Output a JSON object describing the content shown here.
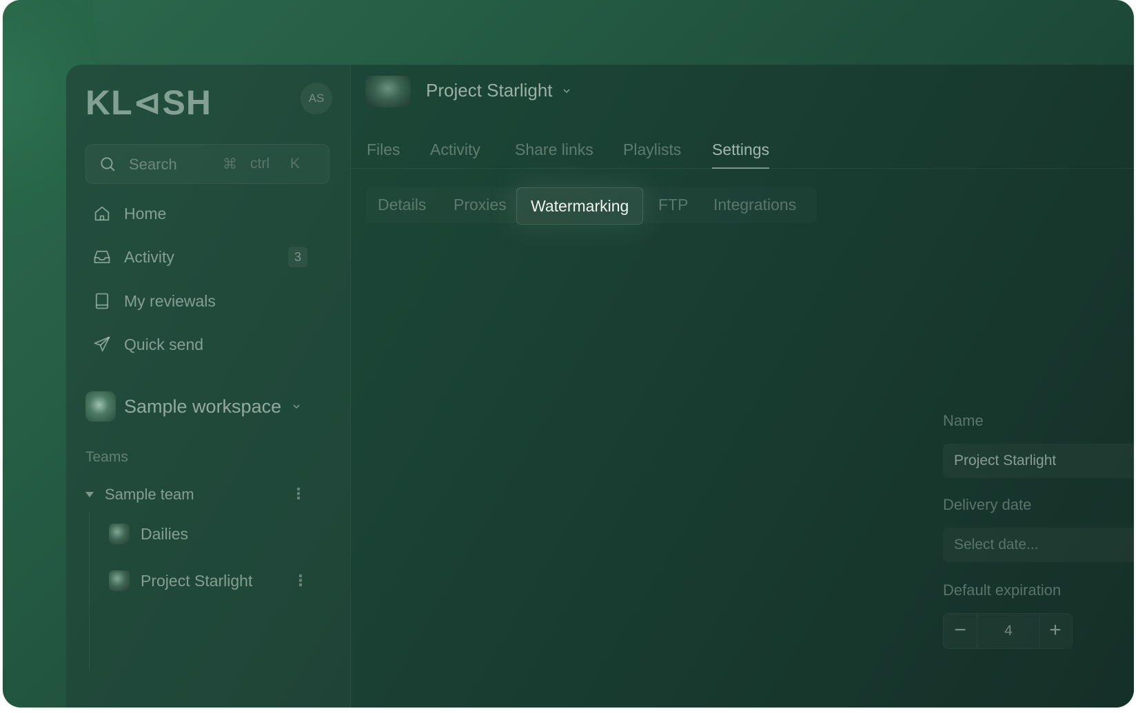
{
  "brand": {
    "logo": "KL⊲SH",
    "user_initials": "AS"
  },
  "search": {
    "placeholder": "Search",
    "shortcut_cmd": "⌘",
    "shortcut_ctrl": "ctrl",
    "shortcut_key": "K"
  },
  "nav": [
    {
      "label": "Home",
      "icon": "home-icon"
    },
    {
      "label": "Activity",
      "icon": "inbox-icon",
      "badge": "3"
    },
    {
      "label": "My reviewals",
      "icon": "book-icon"
    },
    {
      "label": "Quick send",
      "icon": "send-icon"
    }
  ],
  "workspace": {
    "name": "Sample workspace"
  },
  "teams": {
    "label": "Teams",
    "team_name": "Sample team",
    "projects": [
      {
        "name": "Dailies"
      },
      {
        "name": "Project Starlight"
      }
    ]
  },
  "header": {
    "project_title": "Project Starlight"
  },
  "tabs": [
    "Files",
    "Activity",
    "Share links",
    "Playlists",
    "Settings"
  ],
  "active_tab": "Settings",
  "subtabs": [
    "Details",
    "Proxies",
    "Watermarking",
    "FTP",
    "Integrations"
  ],
  "active_subtab": "Watermarking",
  "form": {
    "name_label": "Name",
    "name_value": "Project Starlight",
    "delivery_label": "Delivery date",
    "delivery_placeholder": "Select date...",
    "expiration_label": "Default expiration",
    "expiration_value": "4",
    "minus": "−",
    "plus": "+"
  }
}
